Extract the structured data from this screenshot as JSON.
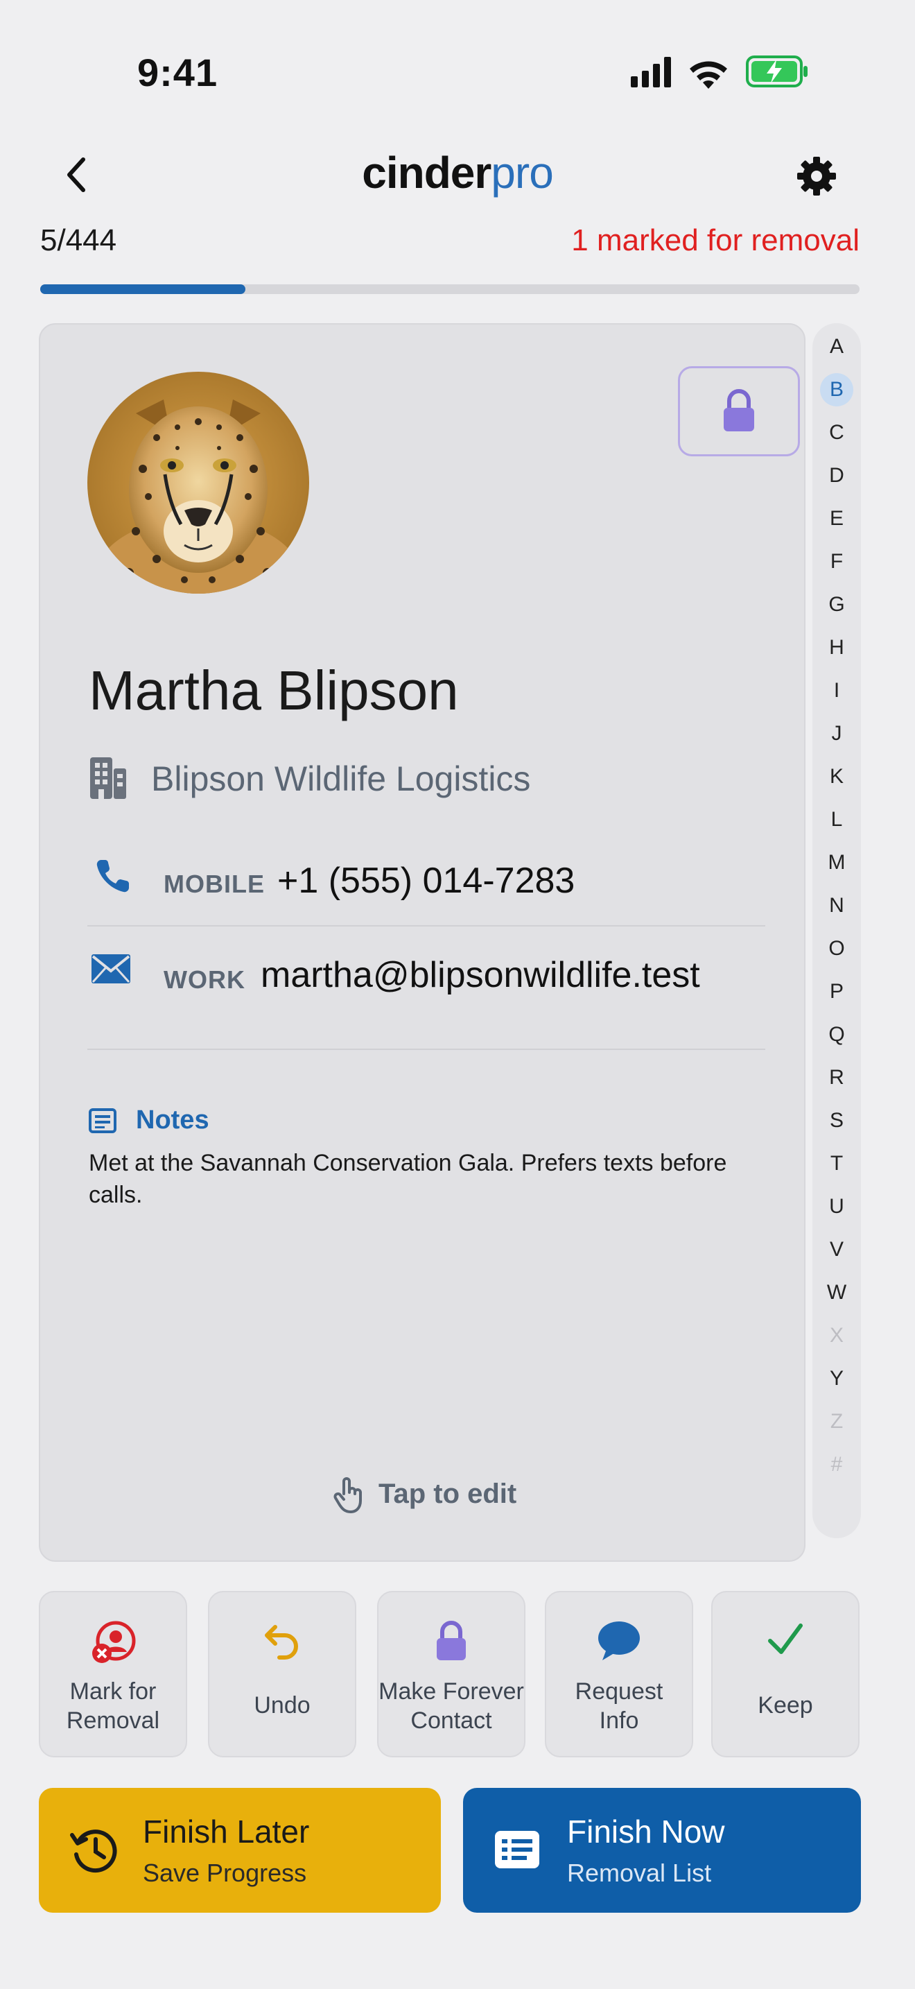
{
  "status_bar": {
    "time": "9:41"
  },
  "header": {
    "logo_part1": "cinder",
    "logo_part2": "pro",
    "counter": "5/444",
    "marked": "1 marked for removal",
    "progress": 0.25
  },
  "contact": {
    "name": "Martha Blipson",
    "company": "Blipson Wildlife Logistics",
    "phone_type": "MOBILE",
    "phone": "+1 (555) 014-7283",
    "email_type": "WORK",
    "email": "martha@blipsonwildlife.test",
    "notes_title": "Notes",
    "notes": "Met at the Savannah Conservation Gala. Prefers texts before calls.",
    "tap_to_edit": "Tap to edit",
    "avatar": "cheetah-photo"
  },
  "index": {
    "letters": [
      "A",
      "B",
      "C",
      "D",
      "E",
      "F",
      "G",
      "H",
      "I",
      "J",
      "K",
      "L",
      "M",
      "N",
      "O",
      "P",
      "Q",
      "R",
      "S",
      "T",
      "U",
      "V",
      "W",
      "X",
      "Y",
      "Z",
      "#"
    ],
    "active": "B",
    "faded": [
      "X",
      "Z",
      "#"
    ]
  },
  "actions": [
    {
      "line1": "Mark for",
      "line2": "Removal",
      "icon": "remove-user-icon",
      "color": "#d9232a"
    },
    {
      "line1": "Undo",
      "line2": "",
      "icon": "undo-icon",
      "color": "#e0a00c"
    },
    {
      "line1": "Make Forever",
      "line2": "Contact",
      "icon": "lock-icon",
      "color": "#7a67d0"
    },
    {
      "line1": "Request",
      "line2": "Info",
      "icon": "chat-bubble-icon",
      "color": "#1f67b0"
    },
    {
      "line1": "Keep",
      "line2": "",
      "icon": "check-icon",
      "color": "#1f9a4c"
    }
  ],
  "bottom": {
    "later_title": "Finish Later",
    "later_sub": "Save Progress",
    "now_title": "Finish Now",
    "now_sub": "Removal List"
  },
  "colors": {
    "accent": "#1f67b0",
    "danger": "#e02020",
    "later_bg": "#e8b00c",
    "now_bg": "#0f5ea8"
  }
}
